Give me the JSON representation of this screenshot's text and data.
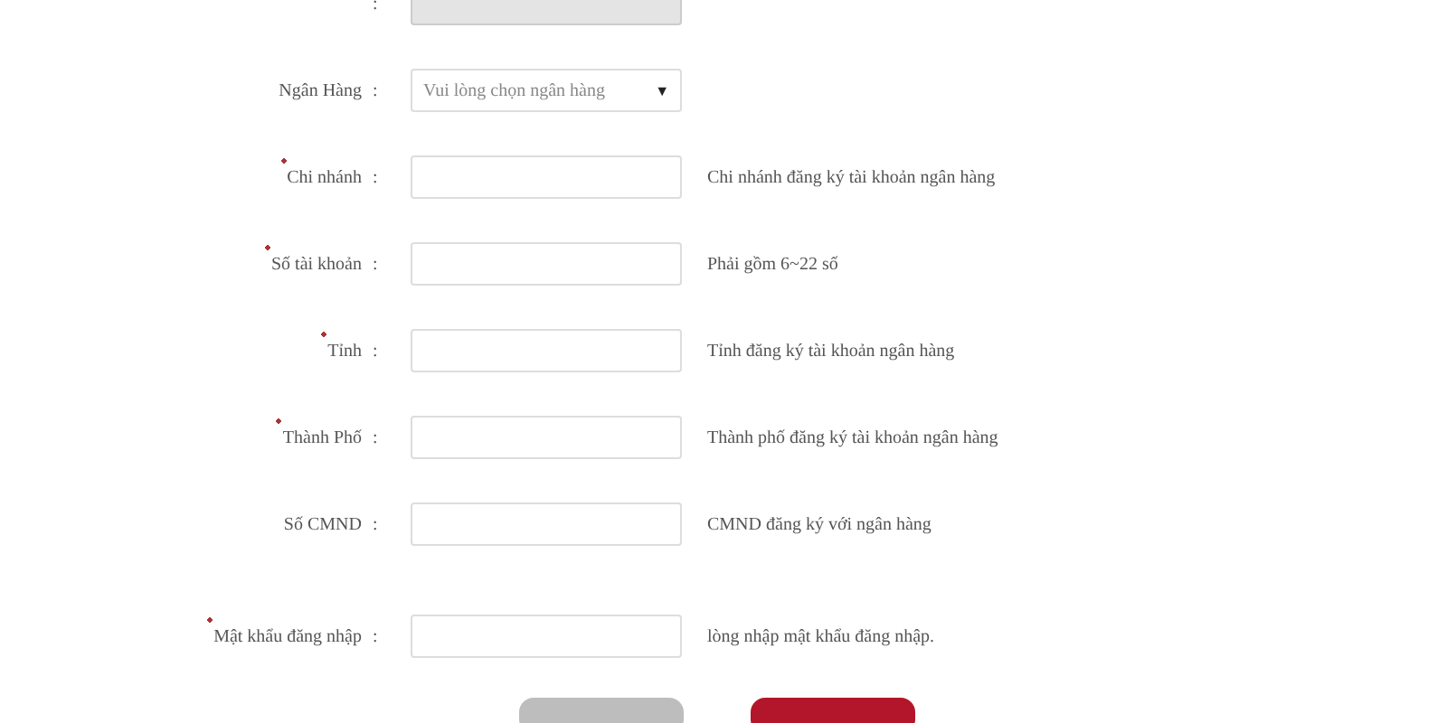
{
  "fields": [
    {
      "kind": "readonly",
      "colon": ":"
    },
    {
      "kind": "select",
      "required": false,
      "label": "Ngân Hàng",
      "colon": ":",
      "placeholder": "Vui lòng chọn ngân hàng",
      "caret": "▼"
    },
    {
      "kind": "text",
      "required": true,
      "label": "Chi nhánh",
      "colon": ":",
      "hint": "Chi nhánh đăng ký tài khoản ngân hàng"
    },
    {
      "kind": "text",
      "required": true,
      "label": "Số tài khoản",
      "colon": ":",
      "hint": "Phải gồm 6~22 số"
    },
    {
      "kind": "text",
      "required": true,
      "label": "Tỉnh",
      "colon": ":",
      "hint": "Tỉnh đăng ký tài khoản ngân hàng"
    },
    {
      "kind": "text",
      "required": true,
      "label": "Thành Phố",
      "colon": ":",
      "hint": "Thành phố đăng ký tài khoản ngân hàng"
    },
    {
      "kind": "text",
      "required": false,
      "label": "Số CMND",
      "colon": ":",
      "hint": "CMND đăng ký với ngân hàng"
    },
    {
      "kind": "password",
      "required": true,
      "label": "Mật khẩu đăng nhập",
      "colon": ":",
      "hint": "lòng nhập mật khẩu đăng nhập."
    }
  ],
  "buttons": [
    {
      "kind": "secondary"
    },
    {
      "kind": "primary"
    }
  ]
}
